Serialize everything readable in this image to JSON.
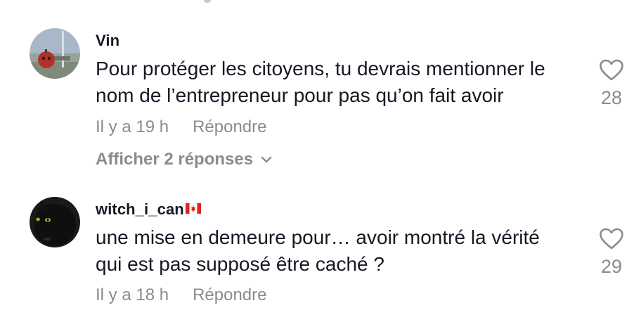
{
  "comments": [
    {
      "username": "Vin",
      "text_lines": [
        "Pour protéger les citoyens, tu devrais mentionner le",
        "nom de l’entrepreneur pour pas qu’on fait avoir"
      ],
      "time": "Il y a 19 h",
      "reply_label": "Répondre",
      "likes": "28",
      "show_replies_label": "Afficher 2 réponses"
    },
    {
      "username": "witch_i_can",
      "flag_icon": "canada-flag-icon",
      "text_lines": [
        "une mise en demeure pour… avoir montré la vérité",
        "qui est pas supposé être caché ?"
      ],
      "time": "Il y a 18 h",
      "reply_label": "Répondre",
      "likes": "29"
    }
  ],
  "icons": {
    "like": "heart-outline-icon",
    "expand": "chevron-down-icon"
  },
  "colors": {
    "primary_text": "#161823",
    "secondary_text": "#8a8b91",
    "flag_red": "#e1241c"
  }
}
